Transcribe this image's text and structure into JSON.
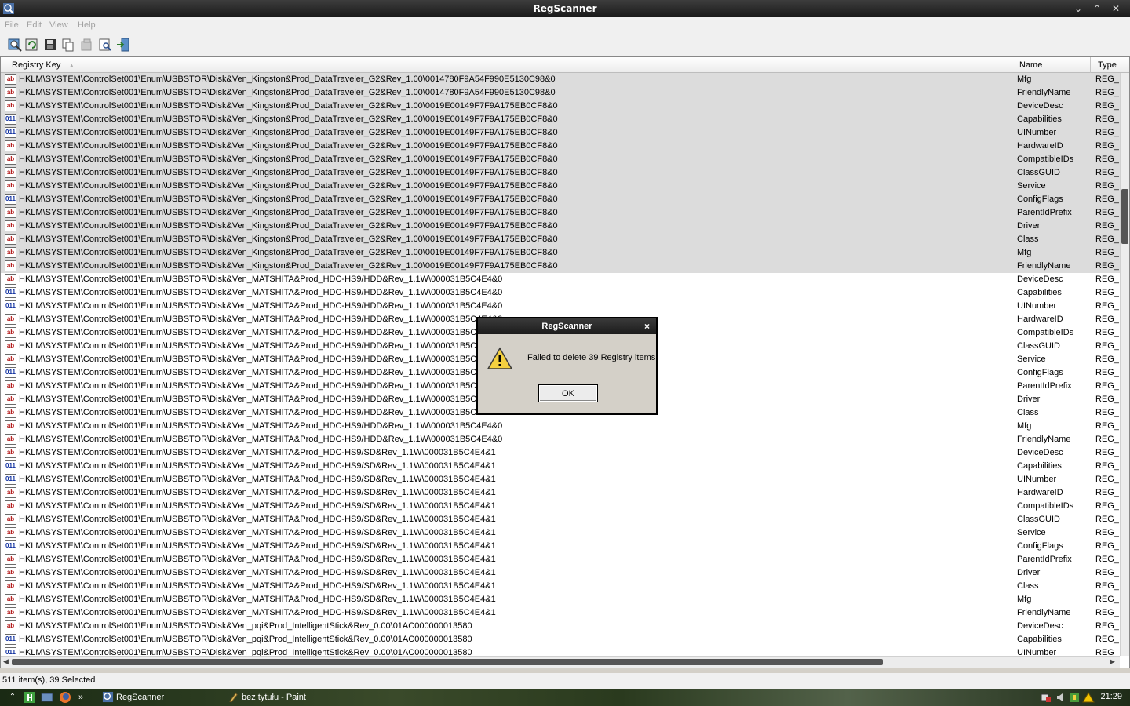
{
  "window": {
    "title": "RegScanner"
  },
  "menu": {
    "items": [
      "File",
      "Edit",
      "View",
      "Help"
    ]
  },
  "toolbar": {
    "icons": [
      "scan-icon",
      "refresh-icon",
      "save-icon",
      "copy-icon",
      "delete-icon",
      "properties-icon",
      "exit-icon"
    ]
  },
  "columns": {
    "key": "Registry Key",
    "name": "Name",
    "type": "Type"
  },
  "rows": [
    {
      "icon": "string",
      "key": "HKLM\\SYSTEM\\ControlSet001\\Enum\\USBSTOR\\Disk&Ven_Kingston&Prod_DataTraveler_G2&Rev_1.00\\0014780F9A54F990E5130C98&0",
      "name": "Mfg",
      "type": "REG_S",
      "selected": true
    },
    {
      "icon": "string",
      "key": "HKLM\\SYSTEM\\ControlSet001\\Enum\\USBSTOR\\Disk&Ven_Kingston&Prod_DataTraveler_G2&Rev_1.00\\0014780F9A54F990E5130C98&0",
      "name": "FriendlyName",
      "type": "REG_S",
      "selected": true
    },
    {
      "icon": "string",
      "key": "HKLM\\SYSTEM\\ControlSet001\\Enum\\USBSTOR\\Disk&Ven_Kingston&Prod_DataTraveler_G2&Rev_1.00\\0019E00149F7F9A175EB0CF8&0",
      "name": "DeviceDesc",
      "type": "REG_S",
      "selected": true
    },
    {
      "icon": "binary",
      "key": "HKLM\\SYSTEM\\ControlSet001\\Enum\\USBSTOR\\Disk&Ven_Kingston&Prod_DataTraveler_G2&Rev_1.00\\0019E00149F7F9A175EB0CF8&0",
      "name": "Capabilities",
      "type": "REG_I",
      "selected": true
    },
    {
      "icon": "binary",
      "key": "HKLM\\SYSTEM\\ControlSet001\\Enum\\USBSTOR\\Disk&Ven_Kingston&Prod_DataTraveler_G2&Rev_1.00\\0019E00149F7F9A175EB0CF8&0",
      "name": "UINumber",
      "type": "REG_I",
      "selected": true
    },
    {
      "icon": "string",
      "key": "HKLM\\SYSTEM\\ControlSet001\\Enum\\USBSTOR\\Disk&Ven_Kingston&Prod_DataTraveler_G2&Rev_1.00\\0019E00149F7F9A175EB0CF8&0",
      "name": "HardwareID",
      "type": "REG_I",
      "selected": true
    },
    {
      "icon": "string",
      "key": "HKLM\\SYSTEM\\ControlSet001\\Enum\\USBSTOR\\Disk&Ven_Kingston&Prod_DataTraveler_G2&Rev_1.00\\0019E00149F7F9A175EB0CF8&0",
      "name": "CompatibleIDs",
      "type": "REG_I",
      "selected": true
    },
    {
      "icon": "string",
      "key": "HKLM\\SYSTEM\\ControlSet001\\Enum\\USBSTOR\\Disk&Ven_Kingston&Prod_DataTraveler_G2&Rev_1.00\\0019E00149F7F9A175EB0CF8&0",
      "name": "ClassGUID",
      "type": "REG_S",
      "selected": true
    },
    {
      "icon": "string",
      "key": "HKLM\\SYSTEM\\ControlSet001\\Enum\\USBSTOR\\Disk&Ven_Kingston&Prod_DataTraveler_G2&Rev_1.00\\0019E00149F7F9A175EB0CF8&0",
      "name": "Service",
      "type": "REG_S",
      "selected": true
    },
    {
      "icon": "binary",
      "key": "HKLM\\SYSTEM\\ControlSet001\\Enum\\USBSTOR\\Disk&Ven_Kingston&Prod_DataTraveler_G2&Rev_1.00\\0019E00149F7F9A175EB0CF8&0",
      "name": "ConfigFlags",
      "type": "REG_I",
      "selected": true
    },
    {
      "icon": "string",
      "key": "HKLM\\SYSTEM\\ControlSet001\\Enum\\USBSTOR\\Disk&Ven_Kingston&Prod_DataTraveler_G2&Rev_1.00\\0019E00149F7F9A175EB0CF8&0",
      "name": "ParentIdPrefix",
      "type": "REG_S",
      "selected": true
    },
    {
      "icon": "string",
      "key": "HKLM\\SYSTEM\\ControlSet001\\Enum\\USBSTOR\\Disk&Ven_Kingston&Prod_DataTraveler_G2&Rev_1.00\\0019E00149F7F9A175EB0CF8&0",
      "name": "Driver",
      "type": "REG_S",
      "selected": true
    },
    {
      "icon": "string",
      "key": "HKLM\\SYSTEM\\ControlSet001\\Enum\\USBSTOR\\Disk&Ven_Kingston&Prod_DataTraveler_G2&Rev_1.00\\0019E00149F7F9A175EB0CF8&0",
      "name": "Class",
      "type": "REG_S",
      "selected": true
    },
    {
      "icon": "string",
      "key": "HKLM\\SYSTEM\\ControlSet001\\Enum\\USBSTOR\\Disk&Ven_Kingston&Prod_DataTraveler_G2&Rev_1.00\\0019E00149F7F9A175EB0CF8&0",
      "name": "Mfg",
      "type": "REG_S",
      "selected": true
    },
    {
      "icon": "string",
      "key": "HKLM\\SYSTEM\\ControlSet001\\Enum\\USBSTOR\\Disk&Ven_Kingston&Prod_DataTraveler_G2&Rev_1.00\\0019E00149F7F9A175EB0CF8&0",
      "name": "FriendlyName",
      "type": "REG_S",
      "selected": true
    },
    {
      "icon": "string",
      "key": "HKLM\\SYSTEM\\ControlSet001\\Enum\\USBSTOR\\Disk&Ven_MATSHITA&Prod_HDC-HS9/HDD&Rev_1.1W\\000031B5C4E4&0",
      "name": "DeviceDesc",
      "type": "REG_S"
    },
    {
      "icon": "binary",
      "key": "HKLM\\SYSTEM\\ControlSet001\\Enum\\USBSTOR\\Disk&Ven_MATSHITA&Prod_HDC-HS9/HDD&Rev_1.1W\\000031B5C4E4&0",
      "name": "Capabilities",
      "type": "REG_I"
    },
    {
      "icon": "binary",
      "key": "HKLM\\SYSTEM\\ControlSet001\\Enum\\USBSTOR\\Disk&Ven_MATSHITA&Prod_HDC-HS9/HDD&Rev_1.1W\\000031B5C4E4&0",
      "name": "UINumber",
      "type": "REG_I"
    },
    {
      "icon": "string",
      "key": "HKLM\\SYSTEM\\ControlSet001\\Enum\\USBSTOR\\Disk&Ven_MATSHITA&Prod_HDC-HS9/HDD&Rev_1.1W\\000031B5C4E4&0",
      "name": "HardwareID",
      "type": "REG_I"
    },
    {
      "icon": "string",
      "key": "HKLM\\SYSTEM\\ControlSet001\\Enum\\USBSTOR\\Disk&Ven_MATSHITA&Prod_HDC-HS9/HDD&Rev_1.1W\\000031B5C4E4&0",
      "name": "CompatibleIDs",
      "type": "REG_I"
    },
    {
      "icon": "string",
      "key": "HKLM\\SYSTEM\\ControlSet001\\Enum\\USBSTOR\\Disk&Ven_MATSHITA&Prod_HDC-HS9/HDD&Rev_1.1W\\000031B5C4E4&0",
      "name": "ClassGUID",
      "type": "REG_S"
    },
    {
      "icon": "string",
      "key": "HKLM\\SYSTEM\\ControlSet001\\Enum\\USBSTOR\\Disk&Ven_MATSHITA&Prod_HDC-HS9/HDD&Rev_1.1W\\000031B5C4E4&0",
      "name": "Service",
      "type": "REG_S"
    },
    {
      "icon": "binary",
      "key": "HKLM\\SYSTEM\\ControlSet001\\Enum\\USBSTOR\\Disk&Ven_MATSHITA&Prod_HDC-HS9/HDD&Rev_1.1W\\000031B5C4E4&0",
      "name": "ConfigFlags",
      "type": "REG_I"
    },
    {
      "icon": "string",
      "key": "HKLM\\SYSTEM\\ControlSet001\\Enum\\USBSTOR\\Disk&Ven_MATSHITA&Prod_HDC-HS9/HDD&Rev_1.1W\\000031B5C4E4&0",
      "name": "ParentIdPrefix",
      "type": "REG_S"
    },
    {
      "icon": "string",
      "key": "HKLM\\SYSTEM\\ControlSet001\\Enum\\USBSTOR\\Disk&Ven_MATSHITA&Prod_HDC-HS9/HDD&Rev_1.1W\\000031B5C4E4&0",
      "name": "Driver",
      "type": "REG_S"
    },
    {
      "icon": "string",
      "key": "HKLM\\SYSTEM\\ControlSet001\\Enum\\USBSTOR\\Disk&Ven_MATSHITA&Prod_HDC-HS9/HDD&Rev_1.1W\\000031B5C4E4&0",
      "name": "Class",
      "type": "REG_S"
    },
    {
      "icon": "string",
      "key": "HKLM\\SYSTEM\\ControlSet001\\Enum\\USBSTOR\\Disk&Ven_MATSHITA&Prod_HDC-HS9/HDD&Rev_1.1W\\000031B5C4E4&0",
      "name": "Mfg",
      "type": "REG_S"
    },
    {
      "icon": "string",
      "key": "HKLM\\SYSTEM\\ControlSet001\\Enum\\USBSTOR\\Disk&Ven_MATSHITA&Prod_HDC-HS9/HDD&Rev_1.1W\\000031B5C4E4&0",
      "name": "FriendlyName",
      "type": "REG_S"
    },
    {
      "icon": "string",
      "key": "HKLM\\SYSTEM\\ControlSet001\\Enum\\USBSTOR\\Disk&Ven_MATSHITA&Prod_HDC-HS9/SD&Rev_1.1W\\000031B5C4E4&1",
      "name": "DeviceDesc",
      "type": "REG_S"
    },
    {
      "icon": "binary",
      "key": "HKLM\\SYSTEM\\ControlSet001\\Enum\\USBSTOR\\Disk&Ven_MATSHITA&Prod_HDC-HS9/SD&Rev_1.1W\\000031B5C4E4&1",
      "name": "Capabilities",
      "type": "REG_I"
    },
    {
      "icon": "binary",
      "key": "HKLM\\SYSTEM\\ControlSet001\\Enum\\USBSTOR\\Disk&Ven_MATSHITA&Prod_HDC-HS9/SD&Rev_1.1W\\000031B5C4E4&1",
      "name": "UINumber",
      "type": "REG_I"
    },
    {
      "icon": "string",
      "key": "HKLM\\SYSTEM\\ControlSet001\\Enum\\USBSTOR\\Disk&Ven_MATSHITA&Prod_HDC-HS9/SD&Rev_1.1W\\000031B5C4E4&1",
      "name": "HardwareID",
      "type": "REG_I"
    },
    {
      "icon": "string",
      "key": "HKLM\\SYSTEM\\ControlSet001\\Enum\\USBSTOR\\Disk&Ven_MATSHITA&Prod_HDC-HS9/SD&Rev_1.1W\\000031B5C4E4&1",
      "name": "CompatibleIDs",
      "type": "REG_I"
    },
    {
      "icon": "string",
      "key": "HKLM\\SYSTEM\\ControlSet001\\Enum\\USBSTOR\\Disk&Ven_MATSHITA&Prod_HDC-HS9/SD&Rev_1.1W\\000031B5C4E4&1",
      "name": "ClassGUID",
      "type": "REG_S"
    },
    {
      "icon": "string",
      "key": "HKLM\\SYSTEM\\ControlSet001\\Enum\\USBSTOR\\Disk&Ven_MATSHITA&Prod_HDC-HS9/SD&Rev_1.1W\\000031B5C4E4&1",
      "name": "Service",
      "type": "REG_S"
    },
    {
      "icon": "binary",
      "key": "HKLM\\SYSTEM\\ControlSet001\\Enum\\USBSTOR\\Disk&Ven_MATSHITA&Prod_HDC-HS9/SD&Rev_1.1W\\000031B5C4E4&1",
      "name": "ConfigFlags",
      "type": "REG_I"
    },
    {
      "icon": "string",
      "key": "HKLM\\SYSTEM\\ControlSet001\\Enum\\USBSTOR\\Disk&Ven_MATSHITA&Prod_HDC-HS9/SD&Rev_1.1W\\000031B5C4E4&1",
      "name": "ParentIdPrefix",
      "type": "REG_S"
    },
    {
      "icon": "string",
      "key": "HKLM\\SYSTEM\\ControlSet001\\Enum\\USBSTOR\\Disk&Ven_MATSHITA&Prod_HDC-HS9/SD&Rev_1.1W\\000031B5C4E4&1",
      "name": "Driver",
      "type": "REG_S"
    },
    {
      "icon": "string",
      "key": "HKLM\\SYSTEM\\ControlSet001\\Enum\\USBSTOR\\Disk&Ven_MATSHITA&Prod_HDC-HS9/SD&Rev_1.1W\\000031B5C4E4&1",
      "name": "Class",
      "type": "REG_S"
    },
    {
      "icon": "string",
      "key": "HKLM\\SYSTEM\\ControlSet001\\Enum\\USBSTOR\\Disk&Ven_MATSHITA&Prod_HDC-HS9/SD&Rev_1.1W\\000031B5C4E4&1",
      "name": "Mfg",
      "type": "REG_S"
    },
    {
      "icon": "string",
      "key": "HKLM\\SYSTEM\\ControlSet001\\Enum\\USBSTOR\\Disk&Ven_MATSHITA&Prod_HDC-HS9/SD&Rev_1.1W\\000031B5C4E4&1",
      "name": "FriendlyName",
      "type": "REG_S"
    },
    {
      "icon": "string",
      "key": "HKLM\\SYSTEM\\ControlSet001\\Enum\\USBSTOR\\Disk&Ven_pqi&Prod_IntelligentStick&Rev_0.00\\01AC000000013580",
      "name": "DeviceDesc",
      "type": "REG_S"
    },
    {
      "icon": "binary",
      "key": "HKLM\\SYSTEM\\ControlSet001\\Enum\\USBSTOR\\Disk&Ven_pqi&Prod_IntelligentStick&Rev_0.00\\01AC000000013580",
      "name": "Capabilities",
      "type": "REG_I"
    },
    {
      "icon": "binary",
      "key": "HKLM\\SYSTEM\\ControlSet001\\Enum\\USBSTOR\\Disk&Ven_pqi&Prod_IntelligentStick&Rev_0.00\\01AC000000013580",
      "name": "UINumber",
      "type": "REG_I"
    }
  ],
  "status": {
    "text": "511 item(s), 39 Selected"
  },
  "dialog": {
    "title": "RegScanner",
    "close": "×",
    "message": "Failed to delete 39 Registry items",
    "ok_label": "OK"
  },
  "taskbar": {
    "tasks": [
      {
        "label": "RegScanner",
        "icon": "regscanner-icon"
      },
      {
        "label": "bez tytułu - Paint",
        "icon": "paint-icon"
      }
    ],
    "clock": "21:29"
  },
  "colors": {
    "selected_row": "#dcdcdc",
    "title_bar": "#1e1e1e"
  }
}
